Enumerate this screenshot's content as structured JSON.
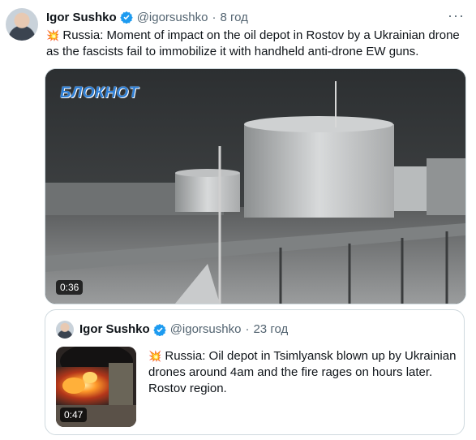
{
  "tweet": {
    "author_name": "Igor Sushko",
    "handle": "@igorsushko",
    "separator": "·",
    "time": "8 год",
    "more": "···",
    "emoji": "💥",
    "text": "Russia: Moment of impact on the oil depot in Rostov by a Ukrainian drone as the fascists fail to immobilize it with handheld anti-drone EW guns.",
    "video": {
      "watermark": "БЛОКНОТ",
      "duration": "0:36"
    }
  },
  "quoted": {
    "author_name": "Igor Sushko",
    "handle": "@igorsushko",
    "separator": "·",
    "time": "23 год",
    "emoji": "💥",
    "text": "Russia: Oil depot in Tsimlyansk blown up by Ukrainian drones around 4am and the fire rages on hours later. Rostov region.",
    "video": {
      "duration": "0:47"
    }
  },
  "colors": {
    "verified": "#1d9bf0",
    "secondary_text": "#536471",
    "border": "#cfd9de",
    "watermark": "#2e7fd6"
  }
}
